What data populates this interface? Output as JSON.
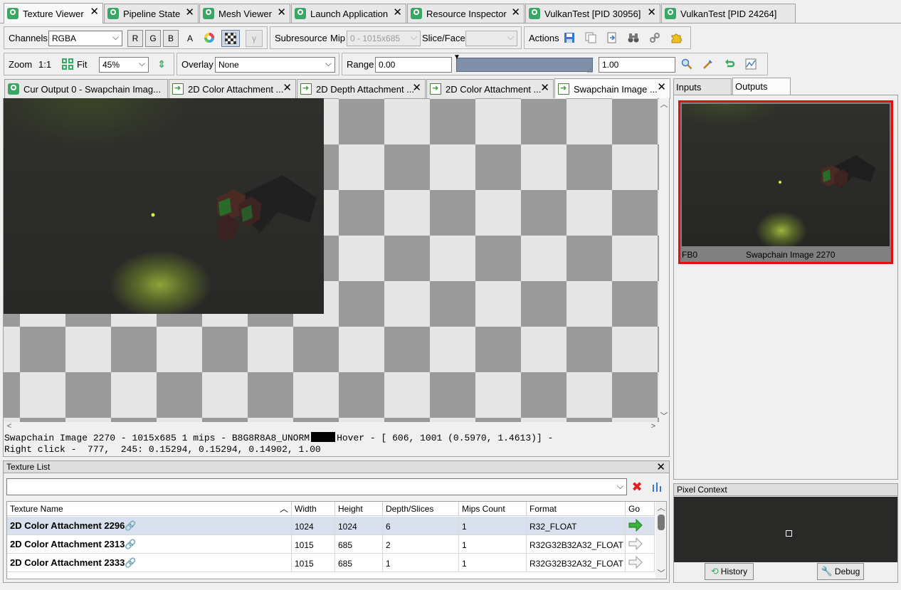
{
  "top_tabs": [
    {
      "label": "Texture Viewer"
    },
    {
      "label": "Pipeline State"
    },
    {
      "label": "Mesh Viewer"
    },
    {
      "label": "Launch Application"
    },
    {
      "label": "Resource Inspector"
    },
    {
      "label": "VulkanTest [PID 30956]"
    },
    {
      "label": "VulkanTest [PID 24264]"
    }
  ],
  "toolbar1": {
    "channels_label": "Channels",
    "channels_value": "RGBA",
    "r": "R",
    "g": "G",
    "b": "B",
    "a": "A",
    "gamma": "γ",
    "subresource_label": "Subresource",
    "mip_label": "Mip",
    "mip_value": "0 - 1015x685",
    "slice_label": "Slice/Face",
    "slice_value": "",
    "actions_label": "Actions"
  },
  "toolbar2": {
    "zoom_label": "Zoom",
    "zoom_1to1": "1:1",
    "fit_label": "Fit",
    "zoom_value": "45%",
    "overlay_label": "Overlay",
    "overlay_value": "None",
    "range_label": "Range",
    "range_min": "0.00",
    "range_max": "1.00"
  },
  "texture_tabs": [
    {
      "label": "Cur Output 0 - Swapchain Imag..."
    },
    {
      "label": "2D Color Attachment ..."
    },
    {
      "label": "2D Depth Attachment ..."
    },
    {
      "label": "2D Color Attachment ..."
    },
    {
      "label": "Swapchain Image ..."
    }
  ],
  "status": {
    "line1": "Swapchain Image 2270 - 1015x685 1 mips - B8G8R8A8_UNORM",
    "hover": "Hover - [ 606, 1001 (0.5970, 1.4613)] -",
    "line2": "Right click -  777,  245: 0.15294, 0.15294, 0.14902, 1.00"
  },
  "side_tabs": {
    "inputs": "Inputs",
    "outputs": "Outputs"
  },
  "output_thumb": {
    "slot": "FB0",
    "name": "Swapchain Image 2270"
  },
  "pixel_context": {
    "title": "Pixel Context",
    "history": "History",
    "debug": "Debug"
  },
  "texture_list": {
    "title": "Texture List",
    "filter_value": "",
    "columns": [
      "Texture Name",
      "Width",
      "Height",
      "Depth/Slices",
      "Mips Count",
      "Format",
      "Go"
    ],
    "rows": [
      {
        "name": "2D Color Attachment 2296",
        "width": "1024",
        "height": "1024",
        "depth": "6",
        "mips": "1",
        "format": "R32_FLOAT"
      },
      {
        "name": "2D Color Attachment 2313",
        "width": "1015",
        "height": "685",
        "depth": "2",
        "mips": "1",
        "format": "R32G32B32A32_FLOAT"
      },
      {
        "name": "2D Color Attachment 2333",
        "width": "1015",
        "height": "685",
        "depth": "1",
        "mips": "1",
        "format": "R32G32B32A32_FLOAT"
      }
    ]
  },
  "colors": {
    "tab_icon": "#3aa864",
    "selection_red": "#e01010",
    "range_bar": "#8090a8",
    "go_arrow": "#3cb43c"
  }
}
